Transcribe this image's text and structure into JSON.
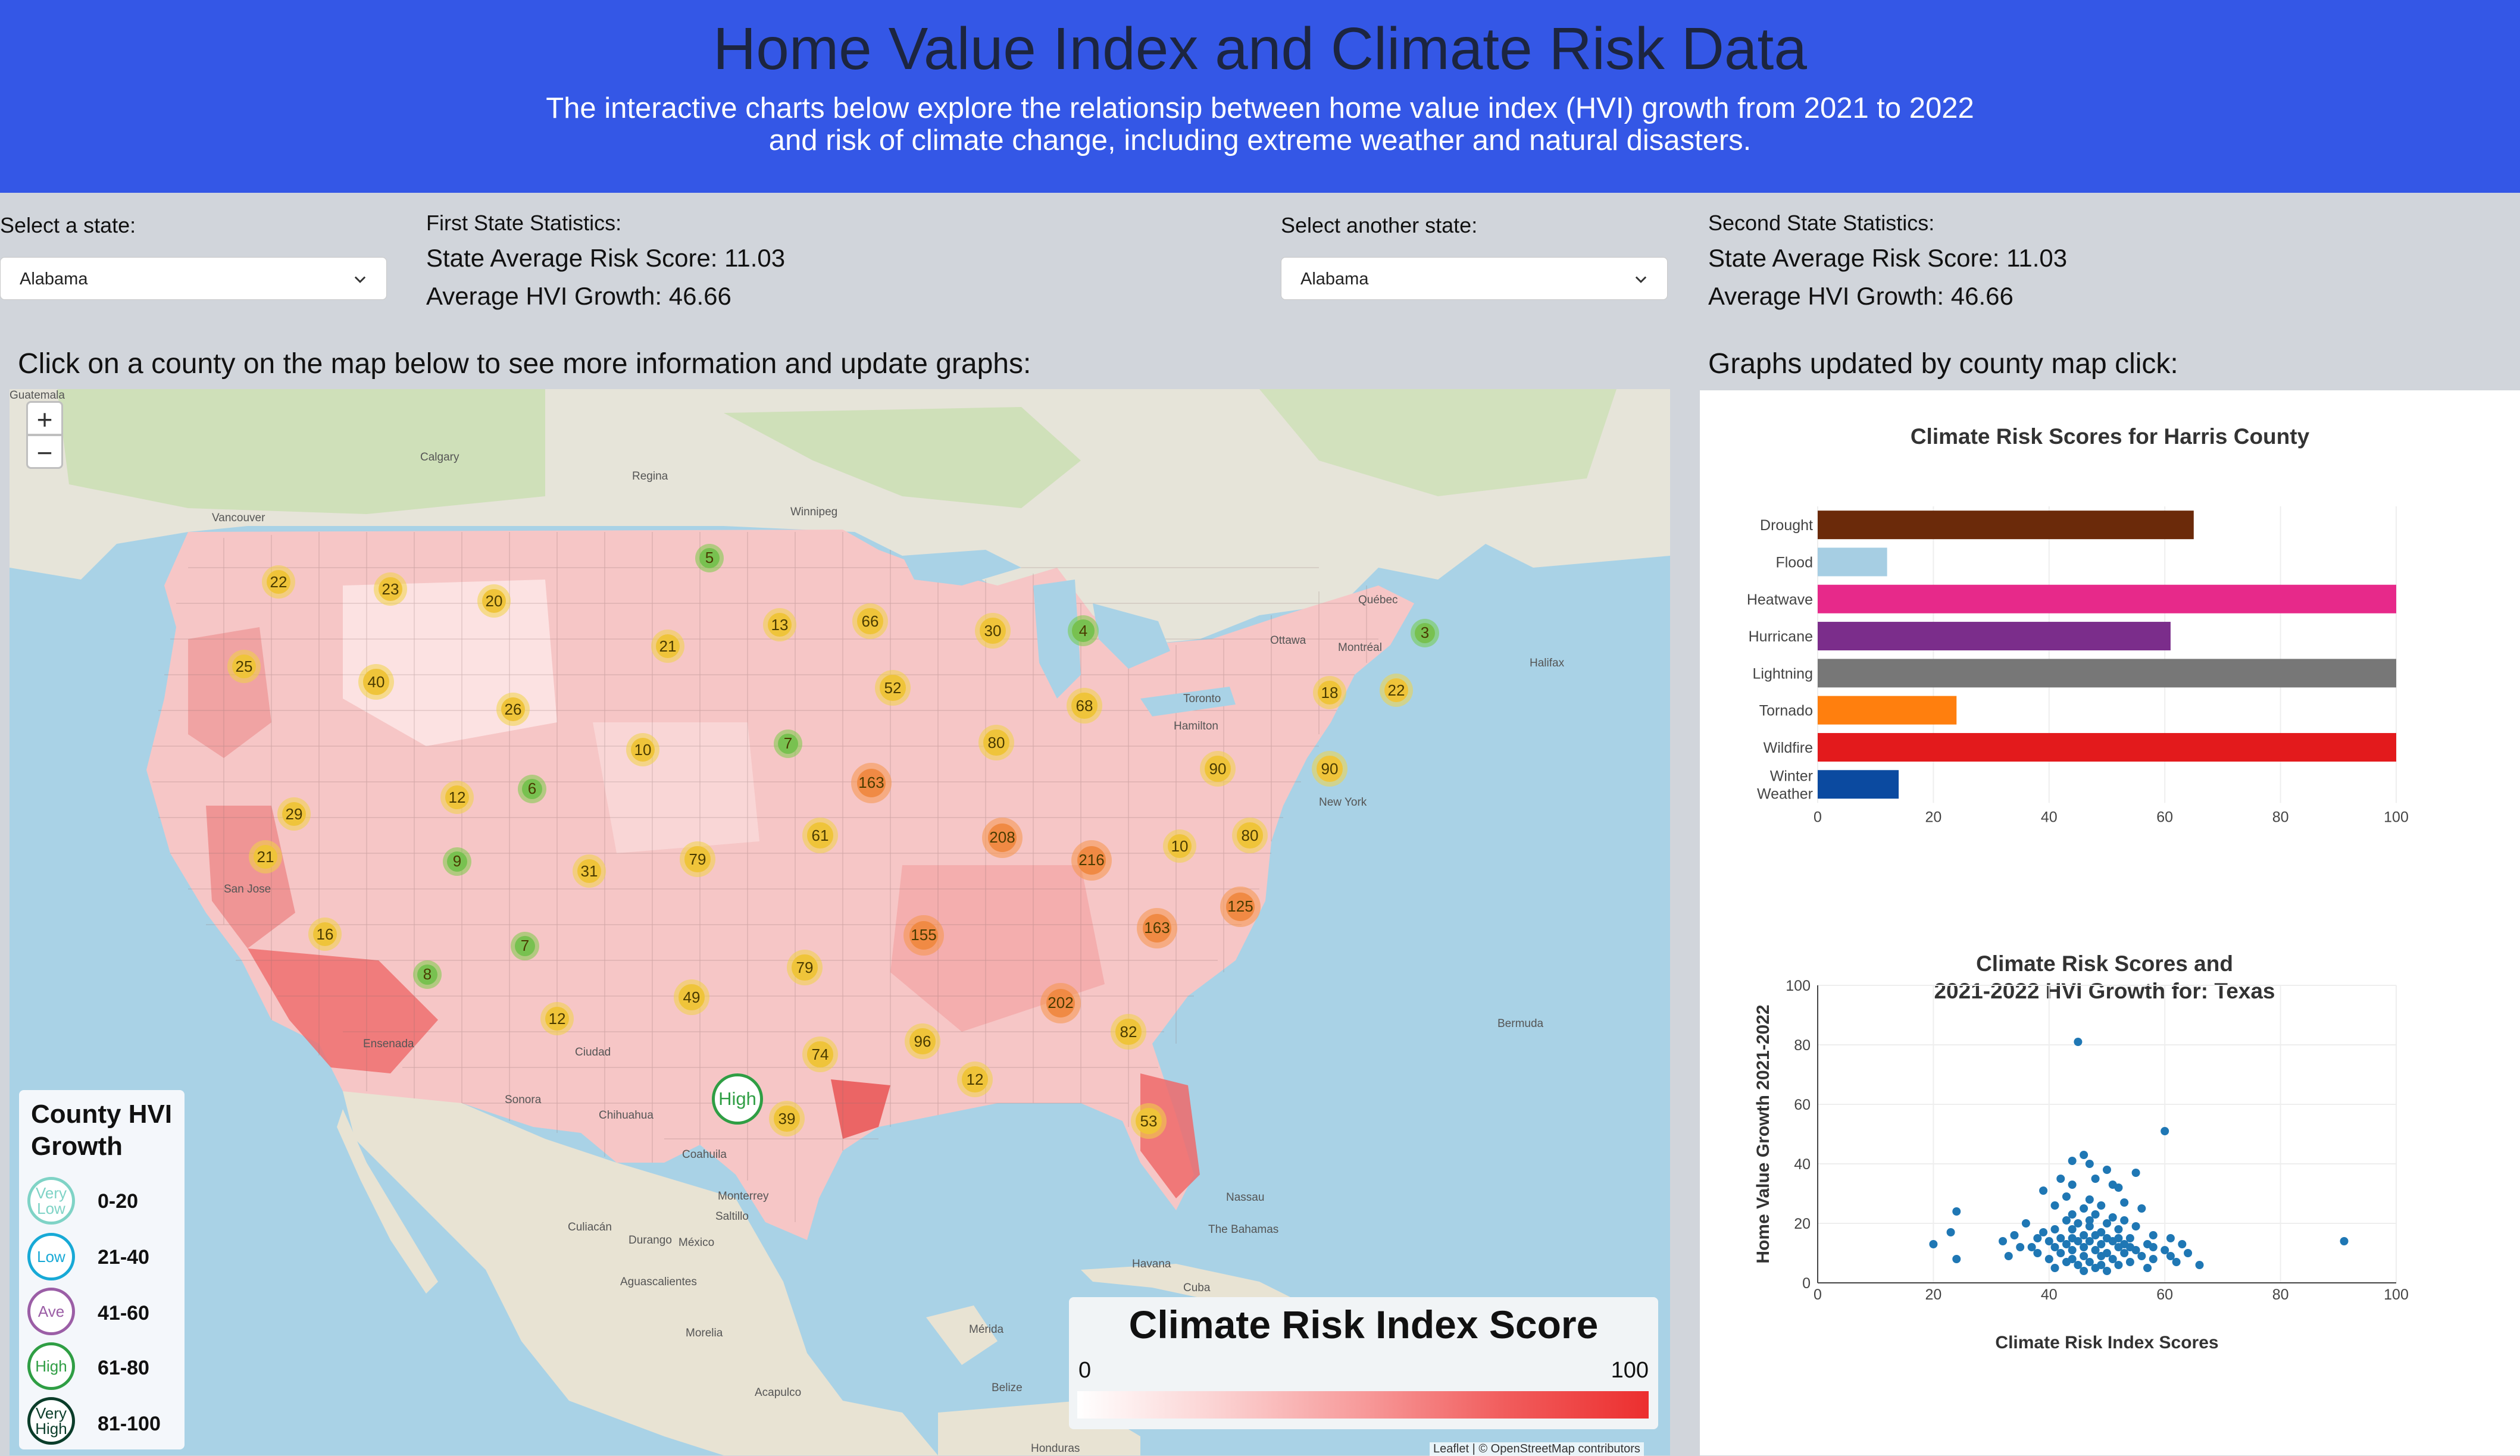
{
  "header": {
    "title": "Home Value Index and Climate Risk Data",
    "subtitle_line1": "The interactive charts below explore the relationsip between home value index (HVI) growth from 2021 to 2022",
    "subtitle_line2": "and risk of climate change, including extreme weather and natural disasters."
  },
  "controls": {
    "first": {
      "label": "Select a state:",
      "selected": "Alabama",
      "stats_title": "First State Statistics:",
      "avg_risk": "State Average Risk Score: 11.03",
      "avg_hvi": "Average HVI Growth: 46.66"
    },
    "second": {
      "label": "Select another state:",
      "selected": "Alabama",
      "stats_title": "Second State Statistics:",
      "avg_risk": "State Average Risk Score: 11.03",
      "avg_hvi": "Average HVI Growth: 46.66"
    }
  },
  "map": {
    "heading": "Click on a county on the map below to see more information and update graphs:",
    "zoom_in": "+",
    "zoom_out": "−",
    "selected_marker": "High",
    "attribution": "Leaflet | © OpenStreetMap contributors",
    "clusters": [
      {
        "count": "22",
        "c": "y"
      },
      {
        "count": "23",
        "c": "y"
      },
      {
        "count": "5",
        "c": "g"
      },
      {
        "count": "20",
        "c": "y"
      },
      {
        "count": "25",
        "c": "y"
      },
      {
        "count": "40",
        "c": "y"
      },
      {
        "count": "21",
        "c": "y"
      },
      {
        "count": "13",
        "c": "y"
      },
      {
        "count": "66",
        "c": "y"
      },
      {
        "count": "30",
        "c": "y"
      },
      {
        "count": "4",
        "c": "g"
      },
      {
        "count": "3",
        "c": "g"
      },
      {
        "count": "26",
        "c": "y"
      },
      {
        "count": "52",
        "c": "y"
      },
      {
        "count": "68",
        "c": "y"
      },
      {
        "count": "18",
        "c": "y"
      },
      {
        "count": "22",
        "c": "y"
      },
      {
        "count": "10",
        "c": "y"
      },
      {
        "count": "7",
        "c": "g"
      },
      {
        "count": "80",
        "c": "y"
      },
      {
        "count": "12",
        "c": "y"
      },
      {
        "count": "6",
        "c": "g"
      },
      {
        "count": "163",
        "c": "o"
      },
      {
        "count": "90",
        "c": "y"
      },
      {
        "count": "90",
        "c": "y"
      },
      {
        "count": "29",
        "c": "y"
      },
      {
        "count": "9",
        "c": "g"
      },
      {
        "count": "31",
        "c": "y"
      },
      {
        "count": "79",
        "c": "y"
      },
      {
        "count": "61",
        "c": "y"
      },
      {
        "count": "208",
        "c": "o"
      },
      {
        "count": "216",
        "c": "o"
      },
      {
        "count": "10",
        "c": "y"
      },
      {
        "count": "80",
        "c": "y"
      },
      {
        "count": "21",
        "c": "y"
      },
      {
        "count": "16",
        "c": "y"
      },
      {
        "count": "7",
        "c": "g"
      },
      {
        "count": "155",
        "c": "o"
      },
      {
        "count": "163",
        "c": "o"
      },
      {
        "count": "125",
        "c": "o"
      },
      {
        "count": "8",
        "c": "g"
      },
      {
        "count": "79",
        "c": "y"
      },
      {
        "count": "12",
        "c": "y"
      },
      {
        "count": "49",
        "c": "y"
      },
      {
        "count": "202",
        "c": "o"
      },
      {
        "count": "82",
        "c": "y"
      },
      {
        "count": "96",
        "c": "y"
      },
      {
        "count": "74",
        "c": "y"
      },
      {
        "count": "12",
        "c": "y"
      },
      {
        "count": "39",
        "c": "y"
      },
      {
        "count": "53",
        "c": "y"
      }
    ],
    "place_labels": [
      "Calgary",
      "Regina",
      "Winnipeg",
      "Vancouver",
      "Québec",
      "Ottawa",
      "Montréal",
      "Toronto",
      "Hamilton",
      "Halifax",
      "New York",
      "San Jose",
      "Ensenada",
      "Sonora",
      "Chihuahua",
      "Coahuila",
      "Monterrey",
      "Saltillo",
      "Culiacán",
      "Durango",
      "México",
      "Aguascalientes",
      "Morelia",
      "Acapulco",
      "Havana",
      "Cuba",
      "Nassau",
      "The Bahamas",
      "Bermuda",
      "Mérida",
      "Belize",
      "Guatemala",
      "Honduras",
      "Ciudad"
    ],
    "hvi_legend": {
      "title_line1": "County HVI",
      "title_line2": "Growth",
      "items": [
        {
          "label": "Very Low",
          "range": "0-20",
          "color": "#7fd3c6"
        },
        {
          "label": "Low",
          "range": "21-40",
          "color": "#17a9d6"
        },
        {
          "label": "Ave",
          "range": "41-60",
          "color": "#9b5ea6"
        },
        {
          "label": "High",
          "range": "61-80",
          "color": "#2f9e44"
        },
        {
          "label": "Very High",
          "range": "81-100",
          "color": "#0b3d2a"
        }
      ]
    },
    "risk_legend": {
      "title": "Climate Risk Index Score",
      "min": "0",
      "max": "100"
    }
  },
  "panel": {
    "heading": "Graphs updated by county map click:"
  },
  "chart_data": [
    {
      "type": "bar",
      "orientation": "horizontal",
      "title": "Climate Risk Scores for Harris County",
      "categories": [
        "Drought",
        "Flood",
        "Heatwave",
        "Hurricane",
        "Lightning",
        "Tornado",
        "Wildfire",
        "Winter Weather"
      ],
      "values": [
        65,
        12,
        100,
        61,
        100,
        24,
        100,
        14
      ],
      "colors": [
        "#6b2a0a",
        "#a6cee3",
        "#e7298a",
        "#7b2d8b",
        "#777777",
        "#ff7f0e",
        "#e31a1c",
        "#0b4aa0"
      ],
      "xlim": [
        0,
        100
      ],
      "xticks": [
        0,
        20,
        40,
        60,
        80,
        100
      ]
    },
    {
      "type": "scatter",
      "title_line1": "Climate Risk Scores and",
      "title_line2": "2021-2022 HVI Growth for:  Texas",
      "xlabel": "Climate Risk Index Scores",
      "ylabel": "Home Value Growth 2021-2022",
      "xlim": [
        0,
        100
      ],
      "ylim": [
        0,
        100
      ],
      "xticks": [
        0,
        20,
        40,
        60,
        80,
        100
      ],
      "yticks": [
        0,
        20,
        40,
        60,
        80,
        100
      ],
      "color": "#1f77b4",
      "points": [
        [
          45,
          81
        ],
        [
          60,
          51
        ],
        [
          91,
          14
        ],
        [
          46,
          43
        ],
        [
          44,
          41
        ],
        [
          47,
          40
        ],
        [
          50,
          38
        ],
        [
          55,
          37
        ],
        [
          42,
          35
        ],
        [
          48,
          35
        ],
        [
          44,
          33
        ],
        [
          51,
          33
        ],
        [
          52,
          32
        ],
        [
          39,
          31
        ],
        [
          43,
          29
        ],
        [
          47,
          28
        ],
        [
          53,
          27
        ],
        [
          41,
          26
        ],
        [
          49,
          26
        ],
        [
          46,
          25
        ],
        [
          56,
          25
        ],
        [
          24,
          24
        ],
        [
          44,
          23
        ],
        [
          48,
          23
        ],
        [
          51,
          22
        ],
        [
          43,
          21
        ],
        [
          53,
          21
        ],
        [
          36,
          20
        ],
        [
          45,
          20
        ],
        [
          50,
          20
        ],
        [
          47,
          19
        ],
        [
          55,
          19
        ],
        [
          41,
          18
        ],
        [
          44,
          18
        ],
        [
          52,
          18
        ],
        [
          23,
          17
        ],
        [
          34,
          16
        ],
        [
          46,
          16
        ],
        [
          48,
          16
        ],
        [
          58,
          16
        ],
        [
          38,
          15
        ],
        [
          42,
          15
        ],
        [
          50,
          15
        ],
        [
          54,
          15
        ],
        [
          61,
          15
        ],
        [
          32,
          14
        ],
        [
          40,
          14
        ],
        [
          45,
          14
        ],
        [
          47,
          14
        ],
        [
          51,
          14
        ],
        [
          20,
          13
        ],
        [
          43,
          13
        ],
        [
          49,
          13
        ],
        [
          53,
          13
        ],
        [
          57,
          13
        ],
        [
          63,
          13
        ],
        [
          35,
          12
        ],
        [
          41,
          12
        ],
        [
          46,
          12
        ],
        [
          52,
          12
        ],
        [
          44,
          11
        ],
        [
          48,
          11
        ],
        [
          55,
          11
        ],
        [
          60,
          11
        ],
        [
          38,
          10
        ],
        [
          42,
          10
        ],
        [
          50,
          10
        ],
        [
          53,
          10
        ],
        [
          64,
          10
        ],
        [
          46,
          9
        ],
        [
          49,
          9
        ],
        [
          56,
          9
        ],
        [
          24,
          8
        ],
        [
          40,
          8
        ],
        [
          44,
          8
        ],
        [
          51,
          8
        ],
        [
          58,
          8
        ],
        [
          43,
          7
        ],
        [
          47,
          7
        ],
        [
          54,
          7
        ],
        [
          62,
          7
        ],
        [
          45,
          6
        ],
        [
          49,
          6
        ],
        [
          52,
          6
        ],
        [
          41,
          5
        ],
        [
          48,
          5
        ],
        [
          57,
          5
        ],
        [
          66,
          6
        ],
        [
          50,
          4
        ],
        [
          46,
          4
        ],
        [
          33,
          9
        ],
        [
          37,
          12
        ],
        [
          39,
          17
        ],
        [
          58,
          12
        ],
        [
          61,
          9
        ],
        [
          44,
          15
        ],
        [
          47,
          21
        ],
        [
          49,
          17
        ],
        [
          52,
          15
        ],
        [
          54,
          12
        ]
      ]
    }
  ]
}
